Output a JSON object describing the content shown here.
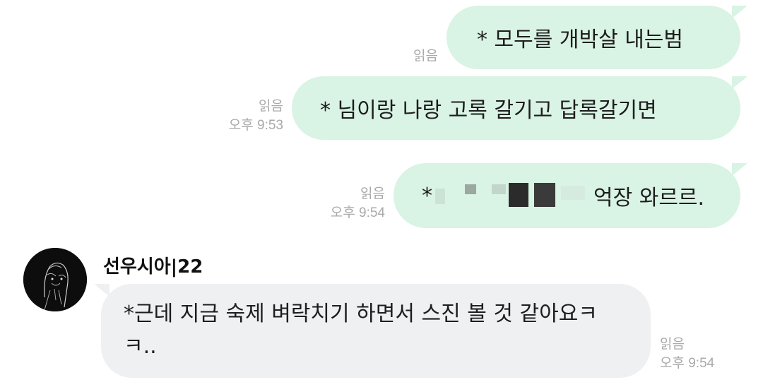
{
  "messages": [
    {
      "side": "me",
      "text": "* 모두를 개박살 내는범",
      "read": "읽음",
      "time": ""
    },
    {
      "side": "me",
      "text": "* 님이랑 나랑 고록 갈기고 답록갈기면",
      "read": "읽음",
      "time": "오후 9:53"
    },
    {
      "side": "me",
      "prefix": "*",
      "suffix": "억장 와르르.",
      "read": "읽음",
      "time": "오후 9:54"
    }
  ],
  "incoming": {
    "sender": "선우시아|22",
    "text": "*근데 지금 숙제 벼락치기 하면서 스진 볼 것 같아요ㅋㅋ..",
    "read": "읽음",
    "time": "오후 9:54"
  },
  "colors": {
    "outgoing": "#d9f3e4",
    "incoming": "#eff0f2",
    "meta": "#a9a9a9"
  }
}
